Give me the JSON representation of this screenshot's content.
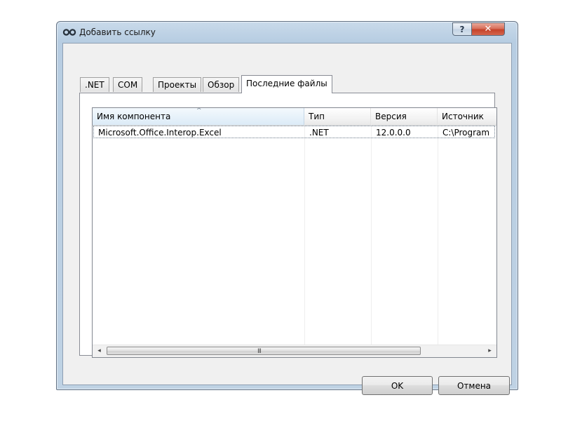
{
  "window": {
    "title": "Добавить ссылку",
    "help_glyph": "?",
    "close_glyph": "✕"
  },
  "tabs": [
    {
      "label": ".NET"
    },
    {
      "label": "COM"
    },
    {
      "label": "Проекты"
    },
    {
      "label": "Обзор"
    },
    {
      "label": "Последние файлы",
      "selected": true
    }
  ],
  "list": {
    "columns": [
      "Имя компонента",
      "Тип",
      "Версия",
      "Источник"
    ],
    "sorted_column": 0,
    "sort_glyph": "^",
    "rows": [
      {
        "name": "Microsoft.Office.Interop.Excel",
        "type": ".NET",
        "version": "12.0.0.0",
        "source": "C:\\Program"
      }
    ],
    "scrollbar": {
      "left_arrow": "◂",
      "right_arrow": "▸",
      "grip": "III"
    }
  },
  "buttons": {
    "ok": "OK",
    "cancel": "Отмена"
  },
  "colors": {
    "frame": "#bfd2e4",
    "close_button": "#c5432a",
    "client": "#f0f0f0"
  }
}
